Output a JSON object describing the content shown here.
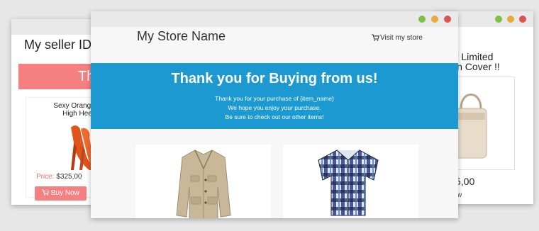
{
  "left_window": {
    "seller_id": "My seller ID",
    "banner_text": "Th",
    "product_title": "Sexy Orange F\nHigh Hee",
    "price_label": "Price:",
    "price_value": "$325,00",
    "buy_label": "Buy Now"
  },
  "right_window": {
    "title_line1": "ar Limited",
    "title_line2": "kin Cover !!",
    "price": "5,00",
    "buy_partial": "w"
  },
  "store": {
    "name": "My Store Name",
    "visit_label": "Visit my store"
  },
  "thank_you": {
    "title": "Thank you for Buying from us!",
    "line1": "Thank you for your purchase of {item_name}",
    "line2": "We hope you enjoy your purchase.",
    "line3": "Be sure to check out our other items!"
  },
  "products": [
    {
      "icon": "jacket-image"
    },
    {
      "icon": "plaid-shirt-image"
    }
  ],
  "colors": {
    "accent_blue": "#1b99d0",
    "accent_pink": "#f57f81",
    "window_green": "#7bc145",
    "window_yellow": "#e5ac3b",
    "window_red": "#d9534f"
  }
}
